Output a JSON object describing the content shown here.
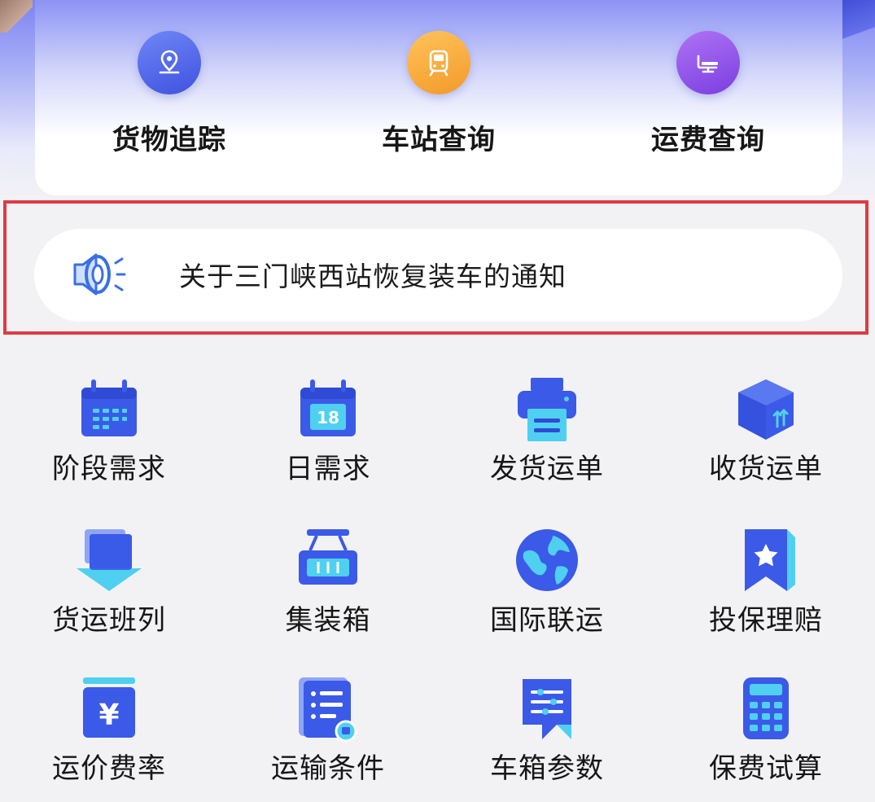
{
  "quick_actions": [
    {
      "label": "货物追踪",
      "icon": "location-pin-icon",
      "color": "#4f63e8"
    },
    {
      "label": "车站查询",
      "icon": "train-icon",
      "color": "#f6a232"
    },
    {
      "label": "运费查询",
      "icon": "monitor-icon",
      "color": "#8a4fe3"
    }
  ],
  "notice": {
    "icon": "speaker-icon",
    "text": "关于三门峡西站恢复装车的通知",
    "highlight_color": "#e03a44"
  },
  "calendar_day": "18",
  "grid": [
    {
      "label": "阶段需求",
      "icon": "calendar-icon"
    },
    {
      "label": "日需求",
      "icon": "calendar-day-icon"
    },
    {
      "label": "发货运单",
      "icon": "printer-icon"
    },
    {
      "label": "收货运单",
      "icon": "package-icon"
    },
    {
      "label": "货运班列",
      "icon": "stack-down-icon"
    },
    {
      "label": "集装箱",
      "icon": "container-icon"
    },
    {
      "label": "国际联运",
      "icon": "globe-icon"
    },
    {
      "label": "投保理赔",
      "icon": "star-bookmark-icon"
    },
    {
      "label": "运价费率",
      "icon": "yen-icon"
    },
    {
      "label": "运输条件",
      "icon": "list-document-icon"
    },
    {
      "label": "车箱参数",
      "icon": "chat-document-icon"
    },
    {
      "label": "保费试算",
      "icon": "calculator-icon"
    }
  ],
  "colors": {
    "accent_blue": "#3a57e6",
    "icon_light_blue": "#4fd0f0",
    "page_background": "#f2f2f4"
  }
}
